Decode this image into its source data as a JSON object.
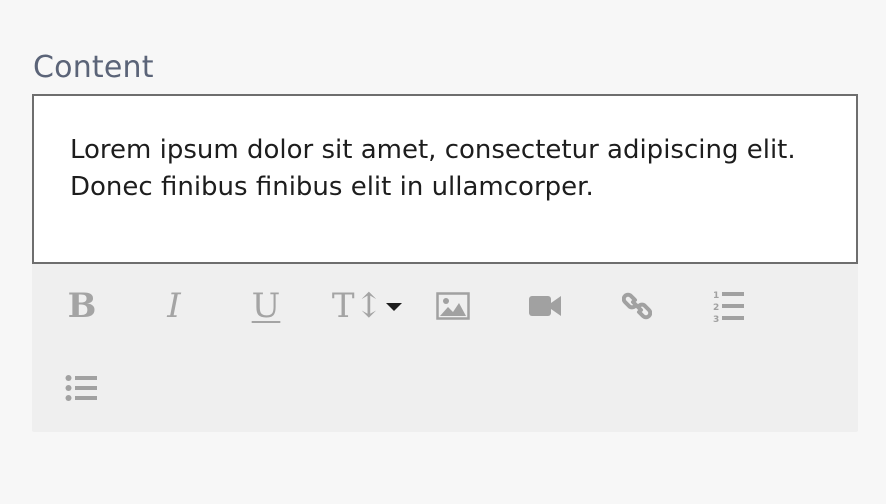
{
  "field": {
    "label": "Content",
    "text": "Lorem ipsum dolor sit amet, consectetur adipiscing elit. Donec finibus finibus elit in ullamcorper."
  },
  "toolbar": {
    "bold_glyph": "B",
    "italic_glyph": "I",
    "underline_glyph": "U",
    "text_size_glyph": "T↕",
    "items": [
      "bold-icon",
      "italic-icon",
      "underline-icon",
      "text-size-icon",
      "image-icon",
      "video-icon",
      "link-icon",
      "ordered-list-icon",
      "unordered-list-icon"
    ]
  },
  "colors": {
    "label": "#5b6478",
    "icon": "#a1a1a1",
    "toolbar_bg": "#efefef",
    "border": "#6e6e6e",
    "caret": "#1d1d1d"
  }
}
